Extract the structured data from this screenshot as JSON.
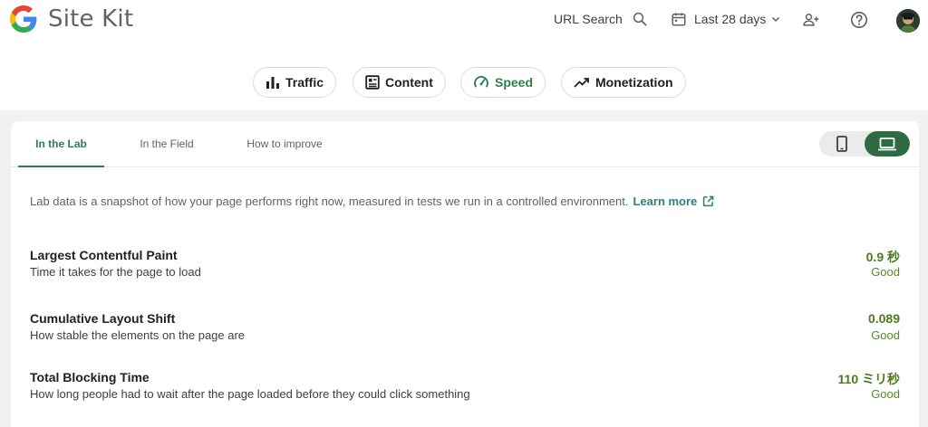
{
  "app": {
    "title": "Site Kit"
  },
  "header": {
    "url_search_label": "URL Search",
    "date_range_label": "Last 28 days"
  },
  "nav_chips": [
    {
      "label": "Traffic",
      "icon": "bar-chart-icon",
      "active": false
    },
    {
      "label": "Content",
      "icon": "article-icon",
      "active": false
    },
    {
      "label": "Speed",
      "icon": "speedometer-icon",
      "active": true
    },
    {
      "label": "Monetization",
      "icon": "trending-up-icon",
      "active": false
    }
  ],
  "tabs": [
    {
      "label": "In the Lab",
      "active": true
    },
    {
      "label": "In the Field",
      "active": false
    },
    {
      "label": "How to improve",
      "active": false
    }
  ],
  "device_toggle": {
    "selected": "desktop",
    "options": [
      "mobile",
      "desktop"
    ]
  },
  "intro": {
    "text": "Lab data is a snapshot of how your page performs right now, measured in tests we run in a controlled environment.",
    "learn_more": "Learn more"
  },
  "metrics": [
    {
      "name": "Largest Contentful Paint",
      "description": "Time it takes for the page to load",
      "value": "0.9 秒",
      "rating": "Good"
    },
    {
      "name": "Cumulative Layout Shift",
      "description": "How stable the elements on the page are",
      "value": "0.089",
      "rating": "Good"
    },
    {
      "name": "Total Blocking Time",
      "description": "How long people had to wait after the page loaded before they could click something",
      "value": "110 ミリ秒",
      "rating": "Good"
    }
  ],
  "colors": {
    "accent": "#2e7d4f",
    "good": "#4b7a1d",
    "link": "#2e7d7a"
  }
}
